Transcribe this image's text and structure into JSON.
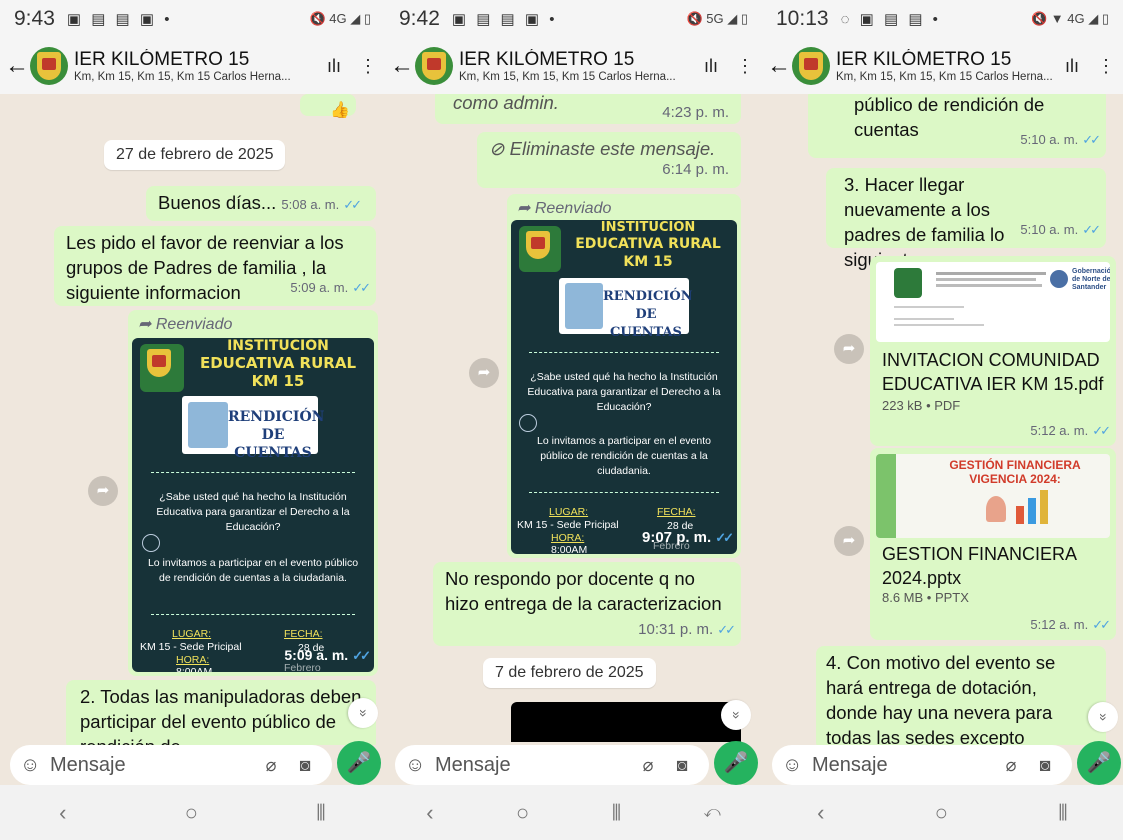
{
  "chat": {
    "title": "IER KILÓMETRO 15",
    "subtitle": "Km, Km 15, Km 15, Km 15 Carlos Herna...",
    "input_placeholder": "Mensaje"
  },
  "screens": [
    {
      "status_time": "9:43",
      "status_notifications": "▣ ▤ ▤ ▣ •",
      "status_icons": "🔇 4G ◢ ▯",
      "date_chip": "27 de febrero de 2025",
      "msg_greeting": "Buenos días...",
      "msg_greeting_time": "5:08 a. m.",
      "msg_request": "Les pido el favor de reenviar a los grupos de Padres de familia , la siguiente informacion",
      "msg_request_time": "5:09 a. m.",
      "forwarded_label": "Reenviado",
      "poster_time": "5:09 a. m.",
      "msg_manipuladoras": "2. Todas las manipuladoras deben participar del evento público de rendición de"
    },
    {
      "status_time": "9:42",
      "status_notifications": "▣ ▤ ▤ ▣ •",
      "status_icons": "🔇 5G ◢ ▯",
      "msg_top_partial": "como admin.",
      "msg_top_time": "4:23 p. m.",
      "msg_deleted": "Eliminaste este mensaje.",
      "msg_deleted_time": "6:14 p. m.",
      "forwarded_label": "Reenviado",
      "poster_time": "9:07 p. m.",
      "msg_docente": "No respondo por docente q no hizo entrega de la caracterizacion",
      "msg_docente_time": "10:31 p. m.",
      "date_chip": "7 de febrero de 2025"
    },
    {
      "status_time": "10:13",
      "status_notifications": "◌ ▣ ▤ ▤ •",
      "status_icons": "🔇 ▼ 4G ◢ ▯",
      "msg_top_partial": "público de rendición de cuentas",
      "msg_top_time": "5:10 a. m.",
      "msg_item3": "3. Hacer llegar nuevamente a los padres de familia lo siguiente",
      "msg_item3_time": "5:10 a. m.",
      "doc1_name": "INVITACION COMUNIDAD EDUCATIVA IER KM 15.pdf",
      "doc1_meta": "223 kB • PDF",
      "doc1_time": "5:12 a. m.",
      "doc1_thumb_org": "Gobernación de Norte de Santander",
      "doc2_name": "GESTION FINANCIERA 2024.pptx",
      "doc2_meta": "8.6 MB • PPTX",
      "doc2_time": "5:12 a. m.",
      "doc2_thumb_title": "GESTIÓN FINANCIERA VIGENCIA 2024:",
      "msg_item4": "4. Con motivo del evento se hará entrega de dotación, donde hay una nevera para todas las sedes excepto"
    }
  ],
  "poster": {
    "title_line1": "INSTITUCION",
    "title_line2": "EDUCATIVA RURAL",
    "title_line3": "KM 15",
    "rendicion_line1": "RENDICIÓN",
    "rendicion_line2": "DE CUENTAS",
    "question": "¿Sabe usted qué ha hecho la Institución Educativa para garantizar el Derecho a la Educación?",
    "invite": "Lo invitamos a participar en el evento público de rendición de cuentas a la ciudadania.",
    "lugar_label": "LUGAR:",
    "lugar_value": "KM 15 - Sede Pricipal",
    "hora_label": "HORA:",
    "hora_value": "8:00AM",
    "fecha_label": "FECHA:",
    "fecha_value": "28 de",
    "fecha_partial": "Febrero"
  },
  "icons": {
    "back": "←",
    "voice": "ılı",
    "more": "⋮",
    "emoji": "☺",
    "attach": "⌀",
    "camera": "◙",
    "mic": "🎤",
    "forward": "➦",
    "scroll": "»",
    "nav_back": "‹",
    "nav_home": "○",
    "nav_recent": "⦀",
    "nav_rotate": "⤺",
    "ticks": "✓✓",
    "deleted": "⊘",
    "thumbs": "👍"
  }
}
